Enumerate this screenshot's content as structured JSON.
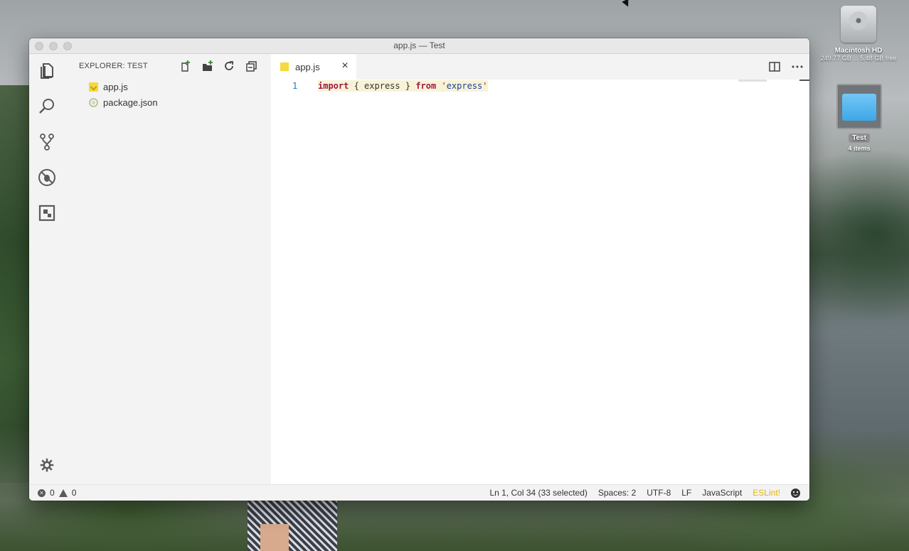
{
  "desktop": {
    "drive_name": "Macintosh HD",
    "drive_info": "249.77 GB ... 5.48 GB free",
    "folder_name": "Test",
    "folder_info": "4 items"
  },
  "window": {
    "title": "app.js — Test"
  },
  "activity_bar": {
    "icons": [
      "files-icon",
      "search-icon",
      "source-control-icon",
      "debug-icon",
      "extensions-icon",
      "gear-icon"
    ]
  },
  "sidebar": {
    "header": "EXPLORER: TEST",
    "files": [
      {
        "name": "app.js",
        "type": "js"
      },
      {
        "name": "package.json",
        "type": "json"
      }
    ]
  },
  "editor": {
    "tab_label": "app.js",
    "close_glyph": "×",
    "line_number": "1",
    "code": {
      "kw_import": "import",
      "brace_open": " { ",
      "identifier": "express",
      "brace_close": " } ",
      "kw_from": "from",
      "space": " ",
      "quote": "'",
      "module": "express"
    }
  },
  "statusbar": {
    "errors": "0",
    "warnings": "0",
    "error_glyph": "×",
    "position": "Ln 1, Col 34 (33 selected)",
    "spaces": "Spaces: 2",
    "encoding": "UTF-8",
    "eol": "LF",
    "language": "JavaScript",
    "linter": "ESLint!",
    "accent_color": "#e6b800"
  }
}
